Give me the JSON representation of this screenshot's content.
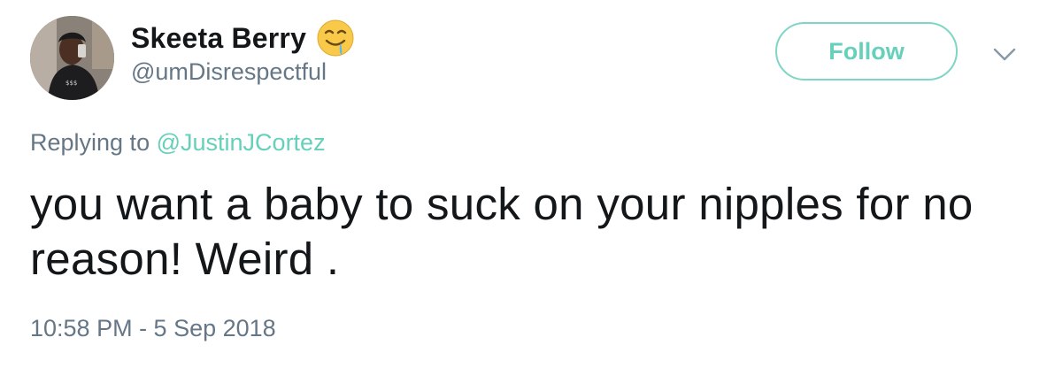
{
  "author": {
    "display_name": "Skeeta Berry",
    "handle": "@umDisrespectful",
    "name_emoji": "drooling-face-emoji",
    "avatar": "profile-photo"
  },
  "follow_button": {
    "label": "Follow"
  },
  "menu": {
    "icon": "chevron-down-icon"
  },
  "reply": {
    "prefix": "Replying to",
    "target": "@JustinJCortez"
  },
  "tweet": {
    "text": "you want a baby to suck on your nipples for no reason! Weird .",
    "timestamp": "10:58 PM - 5 Sep 2018"
  },
  "colors": {
    "accent": "#66d0bb",
    "secondary_text": "#657786",
    "primary_text": "#14171a"
  }
}
